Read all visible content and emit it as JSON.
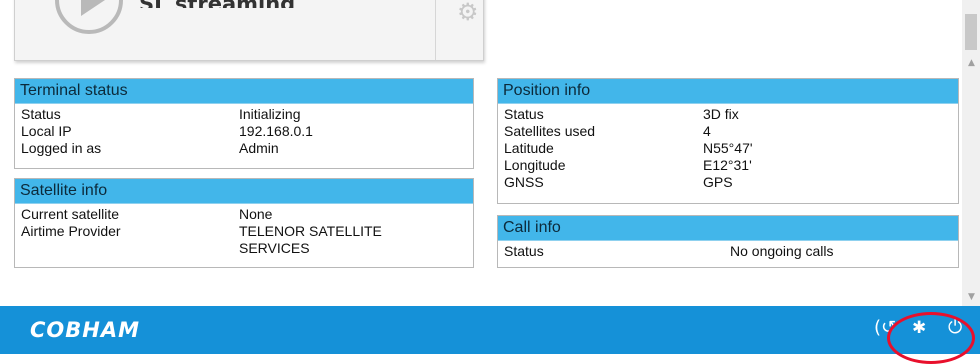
{
  "stream_card": {
    "title": "SL streaming"
  },
  "terminal_status": {
    "title": "Terminal status",
    "rows": [
      {
        "label": "Status",
        "value": "Initializing"
      },
      {
        "label": "Local IP",
        "value": "192.168.0.1"
      },
      {
        "label": "Logged in as",
        "value": "Admin"
      }
    ]
  },
  "satellite_info": {
    "title": "Satellite info",
    "rows": [
      {
        "label": "Current satellite",
        "value": "None"
      },
      {
        "label": "Airtime Provider",
        "value": "TELENOR SATELLITE",
        "value2": "SERVICES"
      }
    ]
  },
  "position_info": {
    "title": "Position info",
    "rows": [
      {
        "label": "Status",
        "value": "3D fix"
      },
      {
        "label": "Satellites used",
        "value": "4"
      },
      {
        "label": "Latitude",
        "value": "N55°47'"
      },
      {
        "label": "Longitude",
        "value": "E12°31'"
      },
      {
        "label": "GNSS",
        "value": "GPS"
      }
    ]
  },
  "call_info": {
    "title": "Call info",
    "rows": [
      {
        "label": "Status",
        "value": "No ongoing calls"
      }
    ]
  },
  "footer": {
    "logo": "COBHAM",
    "icons": [
      "signal-icon",
      "settings-icon",
      "power-icon"
    ],
    "accent": "#1591d8"
  },
  "colors": {
    "panel_header": "#42b6ea",
    "highlight_ring": "#e8102c"
  }
}
